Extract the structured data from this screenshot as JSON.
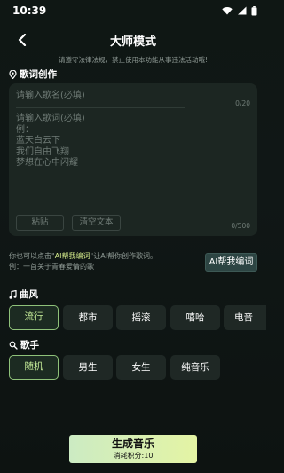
{
  "status_bar": {
    "time": "10:39"
  },
  "header": {
    "title": "大师模式"
  },
  "notice": "请遵守法律法规，禁止使用本功能从事违法活动哦!",
  "lyrics_section": {
    "label": "歌词创作",
    "song_name_placeholder": "请输入歌名(必填)",
    "song_name_count": "0/20",
    "lyrics_placeholder": "请输入歌词(必填)\n例：\n蓝天白云下\n我们自由飞翔\n梦想在心中闪耀",
    "paste_label": "粘贴",
    "clear_label": "清空文本",
    "lyrics_count": "0/500"
  },
  "ai_help": {
    "hint_prefix": "你也可以点击\"",
    "hint_highlight": "AI帮我编词",
    "hint_suffix": "\"让AI帮你创作歌词。",
    "hint_example": "例：一首关于青春爱情的歌",
    "button_label": "AI帮我编词"
  },
  "style_section": {
    "label": "曲风",
    "options": [
      "流行",
      "都市",
      "摇滚",
      "嘻哈",
      "电音"
    ],
    "selected": "流行"
  },
  "singer_section": {
    "label": "歌手",
    "options": [
      "随机",
      "男生",
      "女生",
      "纯音乐"
    ],
    "selected": "随机"
  },
  "generate": {
    "label": "生成音乐",
    "cost": "消耗积分:10"
  },
  "colors": {
    "accent": "#c7ee9a",
    "background": "#0f1714",
    "generate_gradient_start": "#ccebc3",
    "generate_gradient_end": "#e4f4a4"
  },
  "icons": {
    "section_lyrics": "location-pin-icon",
    "section_style": "music-note-icon",
    "section_singer": "user-search-icon"
  }
}
